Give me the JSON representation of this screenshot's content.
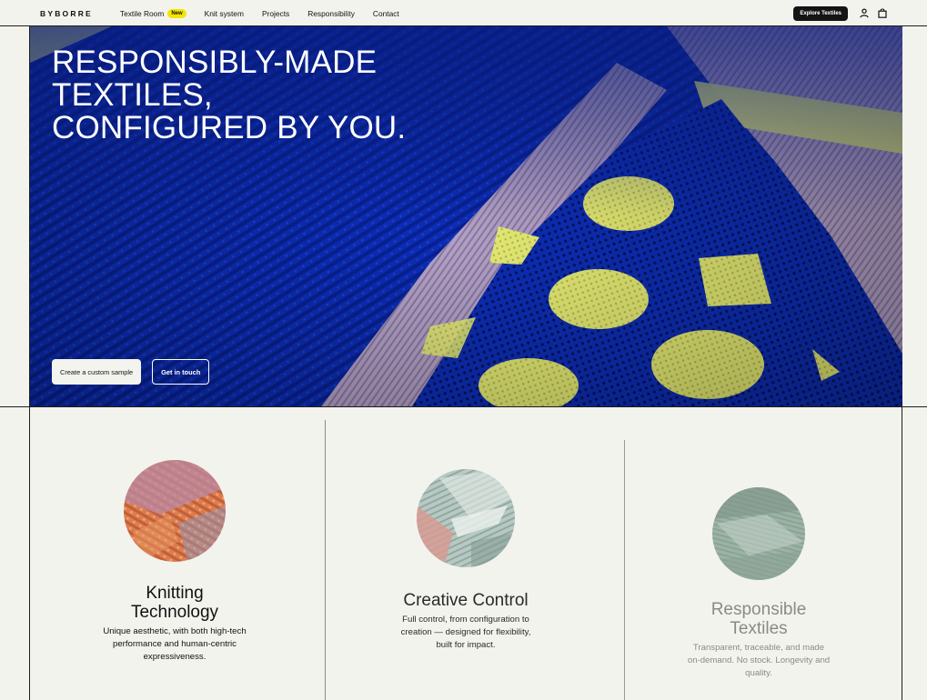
{
  "nav": {
    "logo": "BYBORRE",
    "links": [
      {
        "label": "Textile Room",
        "badge": "New"
      },
      {
        "label": "Knit system"
      },
      {
        "label": "Projects"
      },
      {
        "label": "Responsibility"
      },
      {
        "label": "Contact"
      }
    ],
    "explore_label": "Explore Textiles",
    "icons": [
      "user-icon",
      "shopping-bag-icon"
    ]
  },
  "hero": {
    "title": "RESPONSIBLY-MADE TEXTILES, CONFIGURED BY YOU.",
    "primary_cta": "Create a custom sample",
    "secondary_cta": "Get in touch"
  },
  "features": [
    {
      "title": "Knitting Technology",
      "description": "Unique aesthetic, with both high-tech performance and human-centric expressiveness."
    },
    {
      "title": "Creative Control",
      "description": "Full control, from configuration to creation — designed for flexibility, built for impact."
    },
    {
      "title": "Responsible Textiles",
      "description": "Transparent, traceable, and made on-demand. No stock. Longevity and quality."
    }
  ],
  "colors": {
    "background": "#f3f3ee",
    "badge": "#f5e500",
    "fabric_blue": "#0b2cb3",
    "fabric_yellow": "#e4ec6a",
    "fabric_lilac": "#b4a3c8"
  }
}
